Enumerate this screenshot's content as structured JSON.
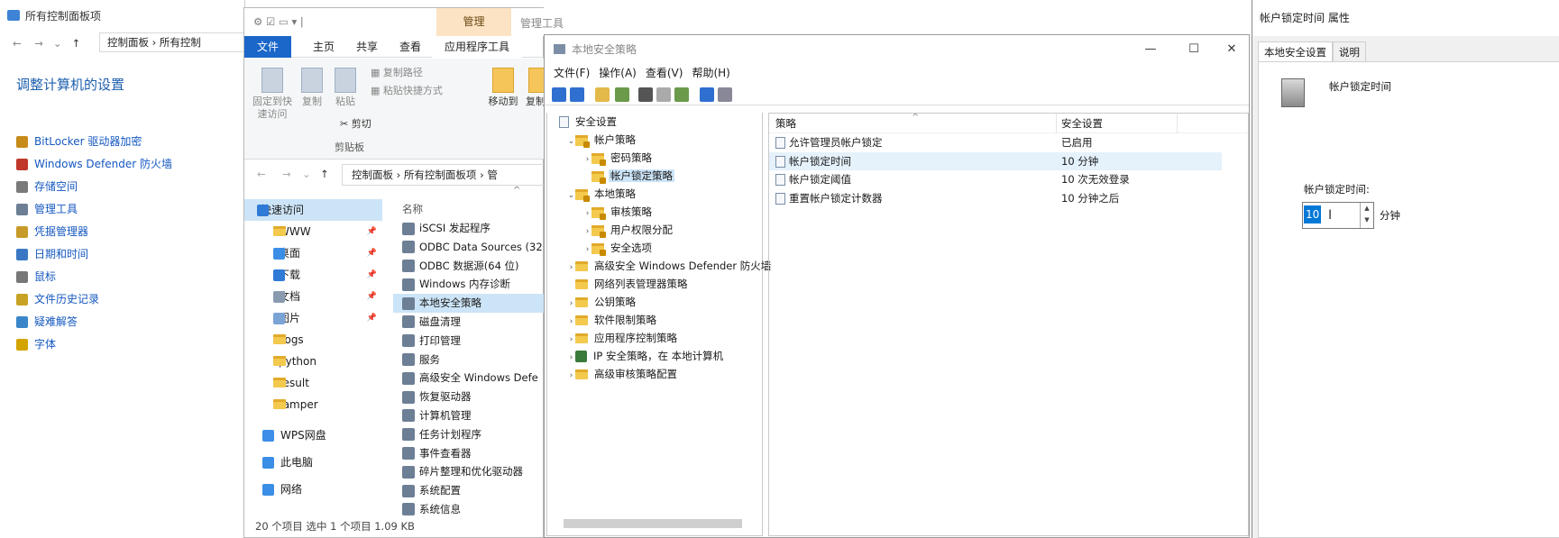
{
  "control_panel": {
    "title": "所有控制面板项",
    "address": "控制面板 › 所有控制",
    "heading": "调整计算机的设置",
    "items": [
      {
        "label": "BitLocker 驱动器加密",
        "icon": "bitlocker-icon"
      },
      {
        "label": "Windows Defender 防火墙",
        "icon": "firewall-icon"
      },
      {
        "label": "存储空间",
        "icon": "storage-icon"
      },
      {
        "label": "管理工具",
        "icon": "admin-tools-icon"
      },
      {
        "label": "凭据管理器",
        "icon": "credential-icon"
      },
      {
        "label": "日期和时间",
        "icon": "clock-icon"
      },
      {
        "label": "鼠标",
        "icon": "mouse-icon"
      },
      {
        "label": "文件历史记录",
        "icon": "history-icon"
      },
      {
        "label": "疑难解答",
        "icon": "troubleshoot-icon"
      },
      {
        "label": "字体",
        "icon": "font-icon"
      }
    ]
  },
  "explorer": {
    "context_tab": "管理",
    "context_title": "管理工具",
    "tabs": [
      "文件",
      "主页",
      "共享",
      "查看",
      "应用程序工具"
    ],
    "ribbon": {
      "pin": "固定到快速访问",
      "copy": "复制",
      "paste": "粘贴",
      "copy_path": "复制路径",
      "paste_shortcut": "粘贴快捷方式",
      "cut": "剪切",
      "clipboard": "剪贴板",
      "move_to": "移动到",
      "copy_to": "复制到"
    },
    "address": "控制面板 › 所有控制面板项 › 管",
    "sidebar": [
      {
        "label": "快速访问",
        "sel": true,
        "pin": false
      },
      {
        "label": "WWW",
        "pin": true
      },
      {
        "label": "桌面",
        "pin": true
      },
      {
        "label": "下载",
        "pin": true
      },
      {
        "label": "文档",
        "pin": true
      },
      {
        "label": "图片",
        "pin": true
      },
      {
        "label": "Logs",
        "pin": false
      },
      {
        "label": "python",
        "pin": false
      },
      {
        "label": "result",
        "pin": false
      },
      {
        "label": "tamper",
        "pin": false
      },
      {
        "label": "WPS网盘",
        "pin": false
      },
      {
        "label": "此电脑",
        "pin": false
      },
      {
        "label": "网络",
        "pin": false
      }
    ],
    "column_name": "名称",
    "files": [
      "iSCSI 发起程序",
      "ODBC Data Sources (32",
      "ODBC 数据源(64 位)",
      "Windows 内存诊断",
      "本地安全策略",
      "磁盘清理",
      "打印管理",
      "服务",
      "高级安全 Windows Defe",
      "恢复驱动器",
      "计算机管理",
      "任务计划程序",
      "事件查看器",
      "碎片整理和优化驱动器",
      "系统配置",
      "系统信息"
    ],
    "selected_file": "本地安全策略",
    "status": "20 个项目    选中 1 个项目  1.09 KB"
  },
  "secpol": {
    "title": "本地安全策略",
    "menu": [
      "文件(F)",
      "操作(A)",
      "查看(V)",
      "帮助(H)"
    ],
    "tree": [
      {
        "label": "安全设置",
        "level": 0,
        "caret": "",
        "icon": "doc"
      },
      {
        "label": "帐户策略",
        "level": 1,
        "caret": "⌄",
        "icon": "lock"
      },
      {
        "label": "密码策略",
        "level": 2,
        "caret": "›",
        "icon": "lock"
      },
      {
        "label": "帐户锁定策略",
        "level": 2,
        "caret": "",
        "icon": "lock",
        "sel": true
      },
      {
        "label": "本地策略",
        "level": 1,
        "caret": "⌄",
        "icon": "lock"
      },
      {
        "label": "审核策略",
        "level": 2,
        "caret": "›",
        "icon": "lock"
      },
      {
        "label": "用户权限分配",
        "level": 2,
        "caret": "›",
        "icon": "lock"
      },
      {
        "label": "安全选项",
        "level": 2,
        "caret": "›",
        "icon": "lock"
      },
      {
        "label": "高级安全 Windows Defender 防火墙",
        "level": 1,
        "caret": "›",
        "icon": "folder"
      },
      {
        "label": "网络列表管理器策略",
        "level": 1,
        "caret": "",
        "icon": "folder"
      },
      {
        "label": "公钥策略",
        "level": 1,
        "caret": "›",
        "icon": "folder"
      },
      {
        "label": "软件限制策略",
        "level": 1,
        "caret": "›",
        "icon": "folder"
      },
      {
        "label": "应用程序控制策略",
        "level": 1,
        "caret": "›",
        "icon": "folder"
      },
      {
        "label": "IP 安全策略，在 本地计算机",
        "level": 1,
        "caret": "›",
        "icon": "shield"
      },
      {
        "label": "高级审核策略配置",
        "level": 1,
        "caret": "›",
        "icon": "folder"
      }
    ],
    "columns": [
      "策略",
      "安全设置"
    ],
    "policies": [
      {
        "name": "允许管理员帐户锁定",
        "value": "已启用"
      },
      {
        "name": "帐户锁定时间",
        "value": "10 分钟",
        "sel": true
      },
      {
        "name": "帐户锁定阈值",
        "value": "10 次无效登录"
      },
      {
        "name": "重置帐户锁定计数器",
        "value": "10 分钟之后"
      }
    ]
  },
  "props": {
    "title": "帐户锁定时间 属性",
    "tabs": [
      "本地安全设置",
      "说明"
    ],
    "policy_name": "帐户锁定时间",
    "field_label": "帐户锁定时间:",
    "value": "10",
    "unit": "分钟"
  }
}
